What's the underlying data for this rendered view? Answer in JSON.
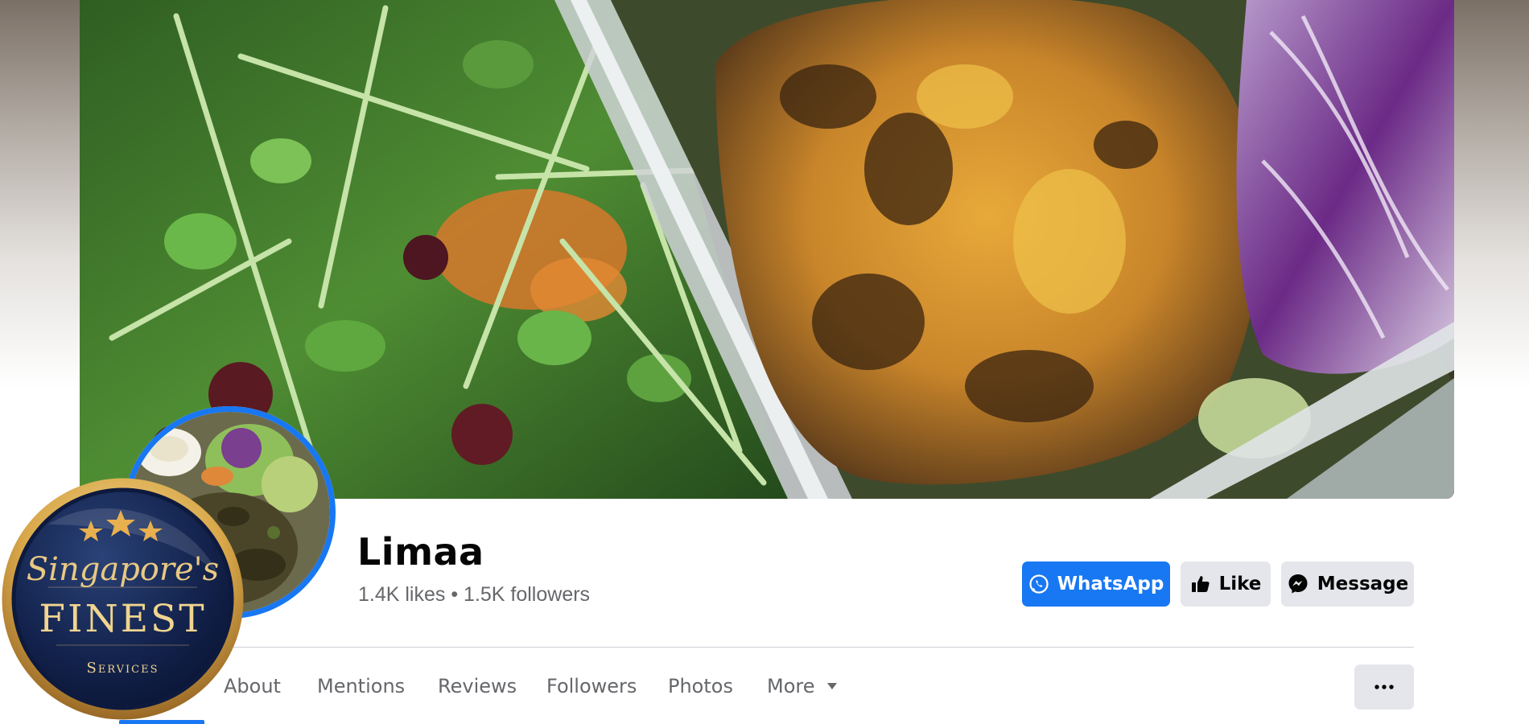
{
  "page": {
    "name": "Limaa",
    "stats": "1.4K likes • 1.5K followers"
  },
  "actions": {
    "whatsapp_label": "WhatsApp",
    "like_label": "Like",
    "message_label": "Message",
    "more_options_icon": "ellipsis-icon"
  },
  "tabs": [
    {
      "label": "About"
    },
    {
      "label": "Mentions"
    },
    {
      "label": "Reviews"
    },
    {
      "label": "Followers"
    },
    {
      "label": "Photos"
    },
    {
      "label": "More"
    }
  ],
  "badge": {
    "line1": "Singapore's",
    "line2": "FINEST",
    "line3": "Services",
    "stars": 3
  },
  "colors": {
    "accent": "#1877f2",
    "button_secondary": "#e4e6eb",
    "muted_text": "#65676b",
    "badge_navy": "#0f1f45",
    "badge_gold": "#d9a84a"
  }
}
